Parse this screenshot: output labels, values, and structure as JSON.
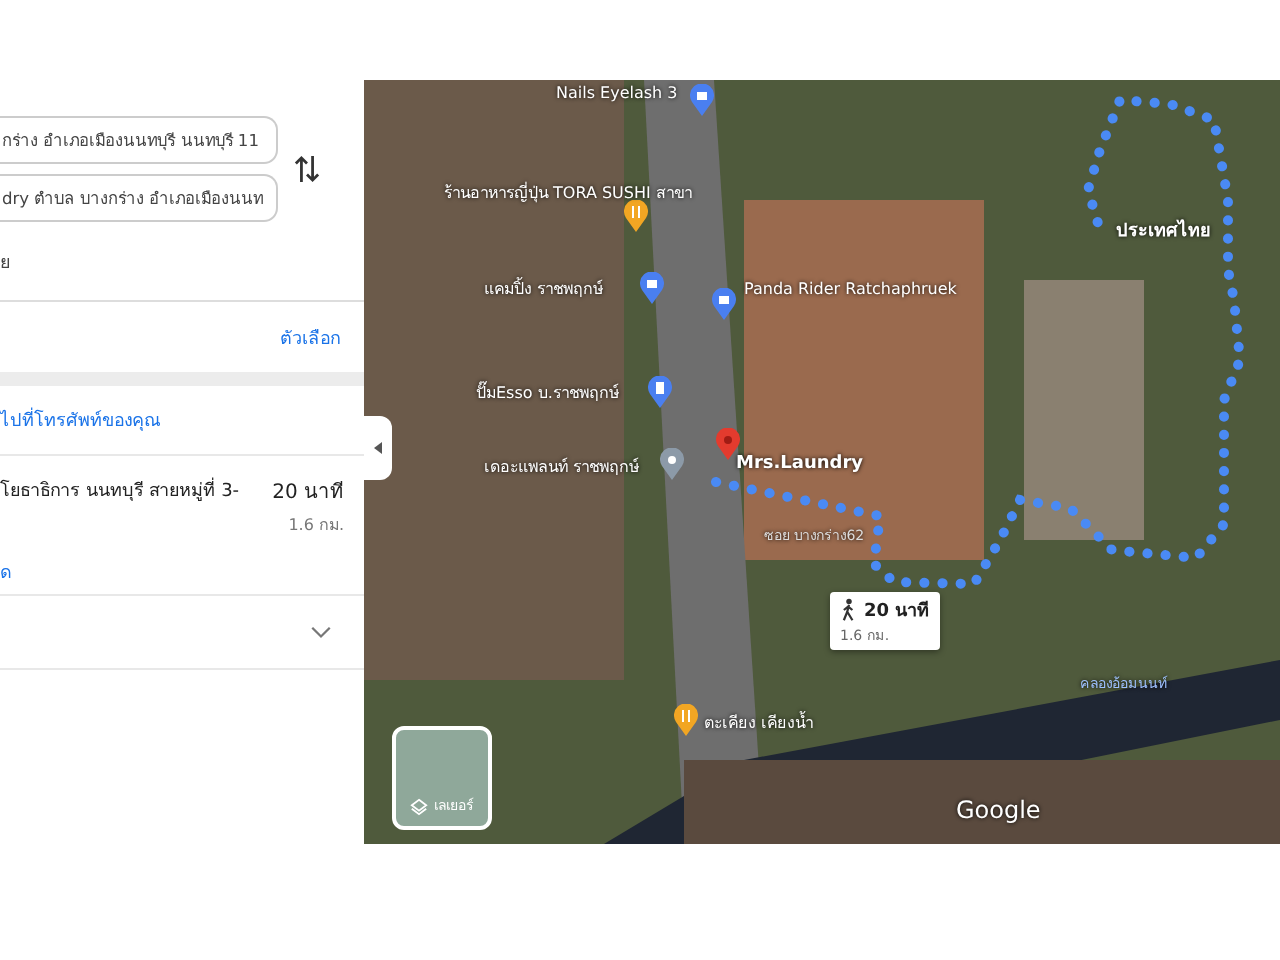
{
  "directions": {
    "origin": {
      "value": "กร่าง อำเภอเมืองนนทบุรี นนทบุรี 11"
    },
    "destination": {
      "value": "dry ตำบล บางกร่าง อำเภอเมืองนนท"
    },
    "note": "ย"
  },
  "options_link": "ตัวเลือก",
  "send_link": "ไปที่โทรศัพท์ของคุณ",
  "route": {
    "name": "โยธาธิการ นนทบุรี สายหมู่ที่ 3-",
    "time": "20 นาที",
    "distance": "1.6 กม.",
    "details_link": "ด"
  },
  "map": {
    "labels": [
      {
        "kind": "place",
        "text": "Nails Eyelash 3"
      },
      {
        "kind": "place",
        "text": "ร้านอาหารญี่ปุ่น TORA SUSHI สาขา"
      },
      {
        "kind": "place",
        "text": "แคมปิ้ง ราชพฤกษ์"
      },
      {
        "kind": "place",
        "text": "Panda Rider Ratchaphruek"
      },
      {
        "kind": "place",
        "text": "ปั๊มEsso บ.ราชพฤกษ์"
      },
      {
        "kind": "place",
        "text": "เดอะแพลนท์ ราชพฤกษ์"
      },
      {
        "kind": "destination",
        "text": "Mrs.Laundry"
      },
      {
        "kind": "street",
        "text": "ซอย บางกร่าง62"
      },
      {
        "kind": "origin",
        "text": "ประเทศไทย"
      },
      {
        "kind": "place",
        "text": "ตะเคียง เคียงน้ำ"
      },
      {
        "kind": "water",
        "text": "คลองอ้อมนนท์"
      }
    ],
    "walk_badge": {
      "time": "20 นาที",
      "distance": "1.6 กม."
    },
    "layers_label": "เลเยอร์",
    "logo": "Google"
  }
}
